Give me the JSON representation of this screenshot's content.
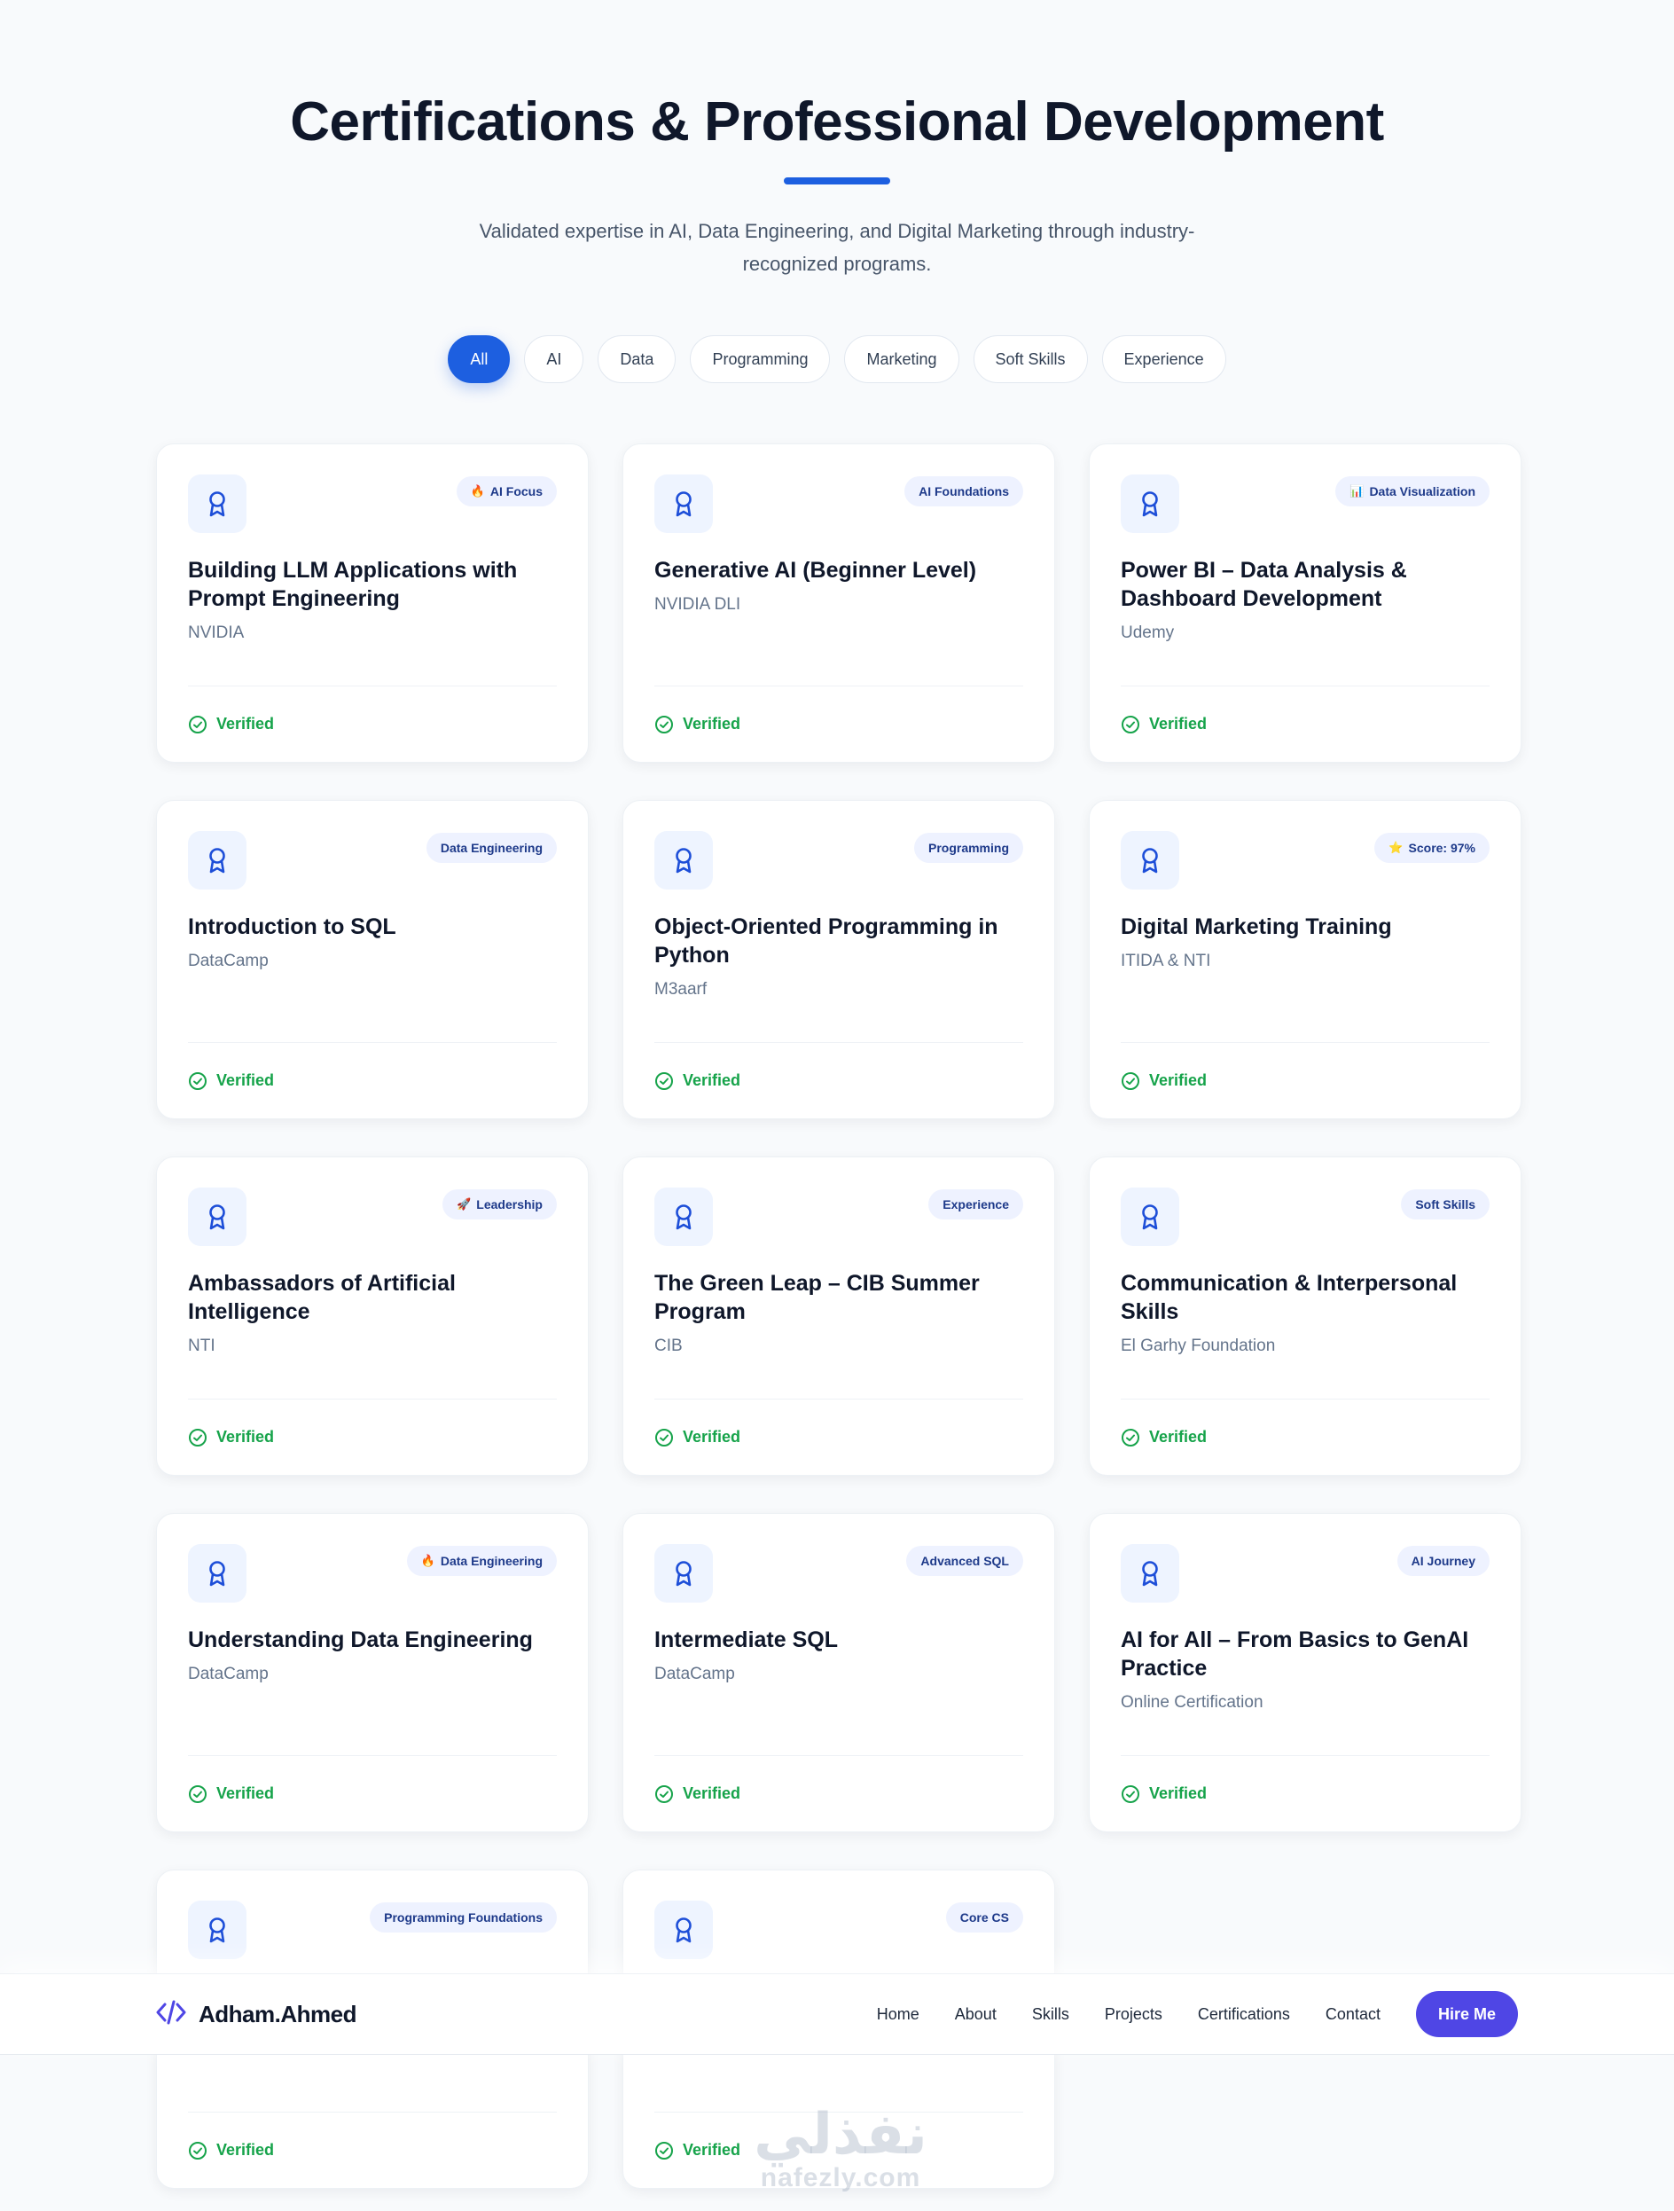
{
  "header": {
    "title": "Certifications & Professional Development",
    "subtitle": "Validated expertise in AI, Data Engineering, and Digital Marketing through industry-recognized programs."
  },
  "filters": [
    "All",
    "AI",
    "Data",
    "Programming",
    "Marketing",
    "Soft Skills",
    "Experience"
  ],
  "active_filter": "All",
  "verified_label": "Verified",
  "cards": [
    {
      "title": "Building LLM Applications with Prompt Engineering",
      "issuer": "NVIDIA",
      "tag": "AI Focus",
      "tag_emoji": "🔥"
    },
    {
      "title": "Generative AI (Beginner Level)",
      "issuer": "NVIDIA DLI",
      "tag": "AI Foundations",
      "tag_emoji": ""
    },
    {
      "title": "Power BI – Data Analysis & Dashboard Development",
      "issuer": "Udemy",
      "tag": "Data Visualization",
      "tag_emoji": "📊"
    },
    {
      "title": "Introduction to SQL",
      "issuer": "DataCamp",
      "tag": "Data Engineering",
      "tag_emoji": ""
    },
    {
      "title": "Object-Oriented Programming in Python",
      "issuer": "M3aarf",
      "tag": "Programming",
      "tag_emoji": ""
    },
    {
      "title": "Digital Marketing Training",
      "issuer": "ITIDA & NTI",
      "tag": "Score: 97%",
      "tag_emoji": "⭐"
    },
    {
      "title": "Ambassadors of Artificial Intelligence",
      "issuer": "NTI",
      "tag": "Leadership",
      "tag_emoji": "🚀"
    },
    {
      "title": "The Green Leap – CIB Summer Program",
      "issuer": "CIB",
      "tag": "Experience",
      "tag_emoji": ""
    },
    {
      "title": "Communication & Interpersonal Skills",
      "issuer": "El Garhy Foundation",
      "tag": "Soft Skills",
      "tag_emoji": ""
    },
    {
      "title": "Understanding Data Engineering",
      "issuer": "DataCamp",
      "tag": "Data Engineering",
      "tag_emoji": "🔥"
    },
    {
      "title": "Intermediate SQL",
      "issuer": "DataCamp",
      "tag": "Advanced SQL",
      "tag_emoji": ""
    },
    {
      "title": "AI for All – From Basics to GenAI Practice",
      "issuer": "Online Certification",
      "tag": "AI Journey",
      "tag_emoji": ""
    },
    {
      "title": "",
      "issuer": "",
      "tag": "Programming Foundations",
      "tag_emoji": ""
    },
    {
      "title": "",
      "issuer": "",
      "tag": "Core CS",
      "tag_emoji": ""
    }
  ],
  "navbar": {
    "brand_name": "Adham.Ahmed",
    "links": [
      "Home",
      "About",
      "Skills",
      "Projects",
      "Certifications",
      "Contact"
    ],
    "cta": "Hire Me"
  },
  "watermark": {
    "arabic": "نفذلي",
    "latin": "nafezly.com"
  },
  "colors": {
    "accent": "#1d5fe0",
    "cta": "#4f46e5",
    "verified": "#16a34a",
    "tag_bg": "#eef2ff"
  },
  "icons": {
    "card": "award-ribbon-icon",
    "verified": "check-circle-icon",
    "brand": "code-brackets-icon"
  }
}
